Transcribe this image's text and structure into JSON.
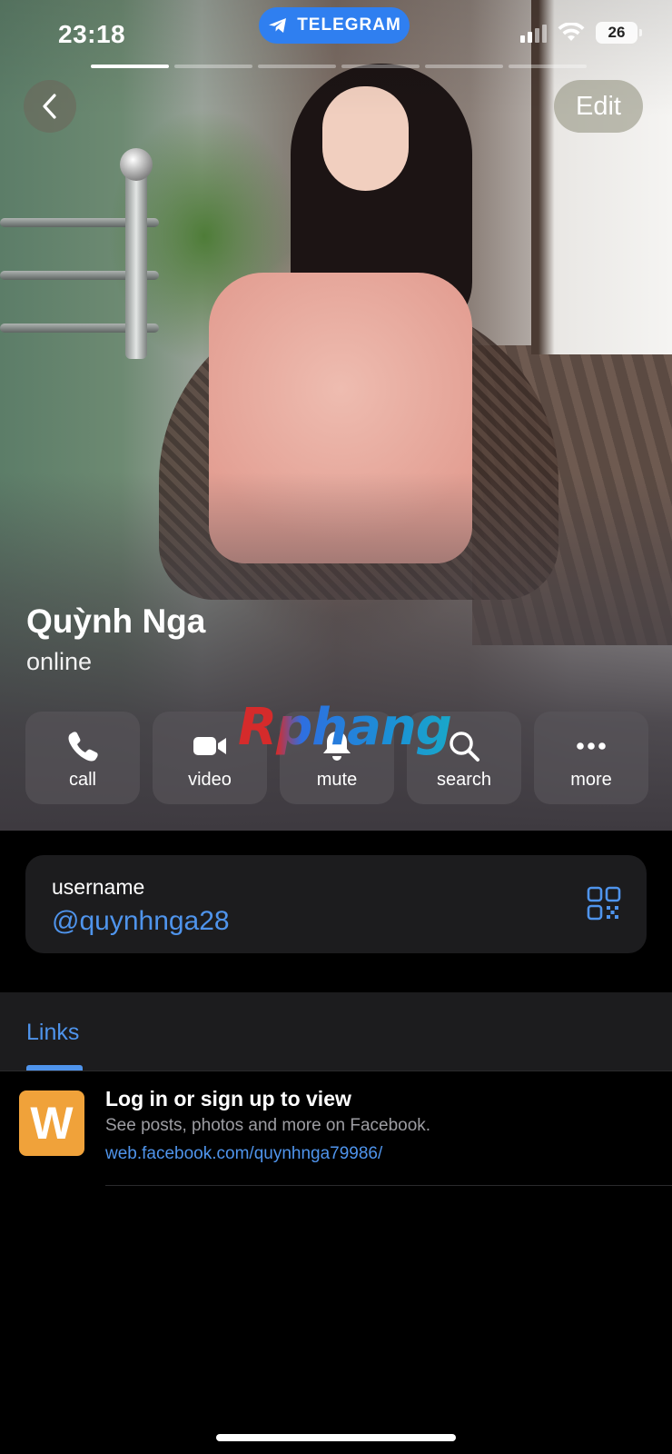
{
  "status_bar": {
    "time": "23:18",
    "app_badge": "TELEGRAM",
    "battery": "26"
  },
  "nav": {
    "back_icon": "chevron-left-icon",
    "edit_label": "Edit"
  },
  "profile": {
    "name": "Quỳnh Nga",
    "status": "online"
  },
  "actions": [
    {
      "label": "call",
      "icon": "phone-icon"
    },
    {
      "label": "video",
      "icon": "video-camera-icon"
    },
    {
      "label": "mute",
      "icon": "bell-icon"
    },
    {
      "label": "search",
      "icon": "search-icon"
    },
    {
      "label": "more",
      "icon": "more-dots-icon"
    }
  ],
  "watermark": "Rphang",
  "username_card": {
    "label": "username",
    "value": "@quynhnga28",
    "icon": "qr-code-icon"
  },
  "links": {
    "tab_label": "Links",
    "items": [
      {
        "thumb_letter": "W",
        "title": "Log in or sign up to view",
        "description": "See posts, photos and more on Facebook.",
        "url": "web.facebook.com/quynhnga79986/"
      }
    ]
  },
  "colors": {
    "accent": "#4f94ec",
    "telegram_pill": "#2f7ff0",
    "card_bg": "#1c1c1e",
    "thumb_bg": "#f0a23a"
  }
}
